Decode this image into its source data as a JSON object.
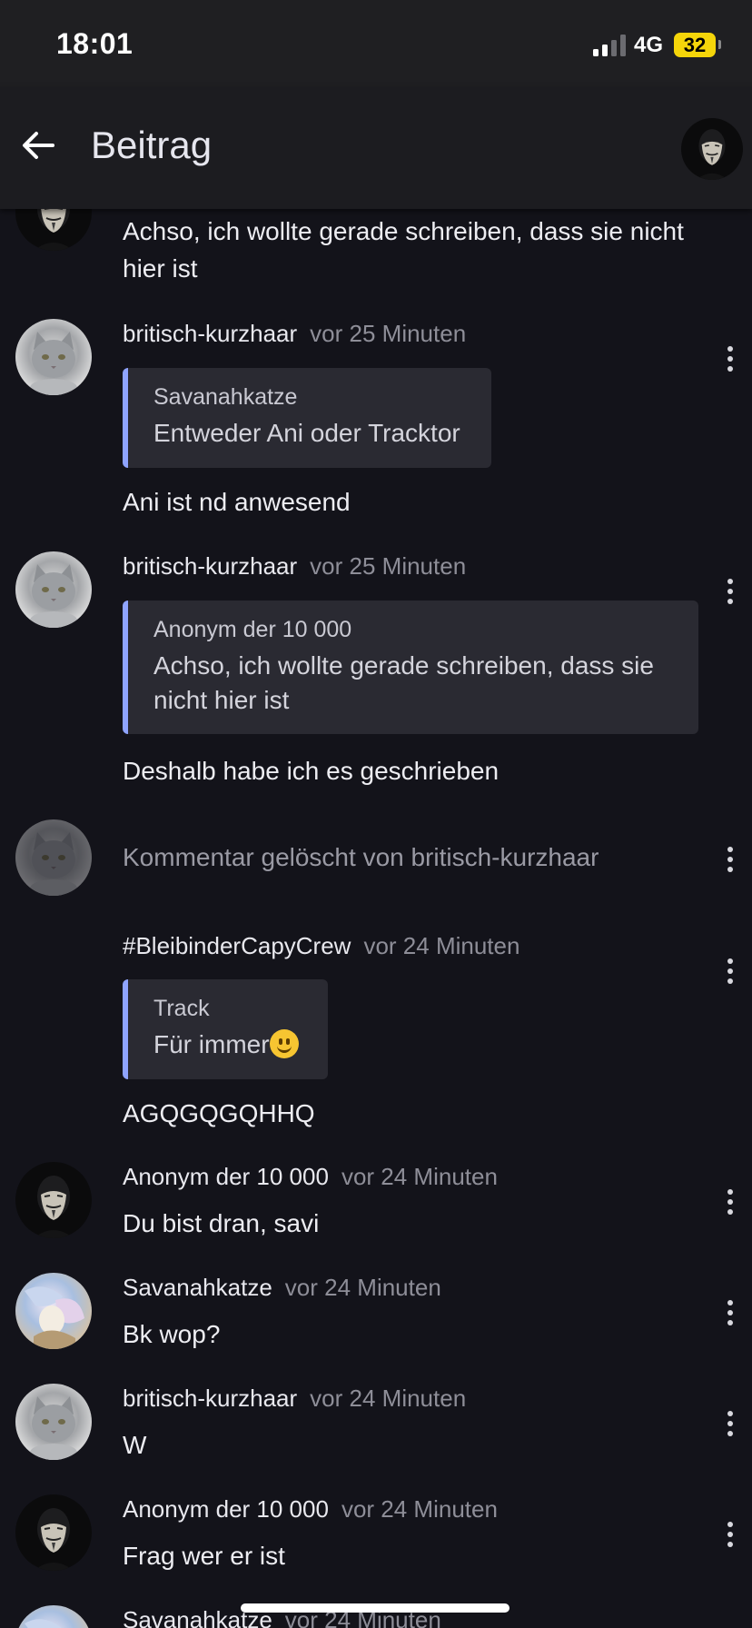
{
  "status_bar": {
    "time": "18:01",
    "network": "4G",
    "battery": "32"
  },
  "header": {
    "title": "Beitrag"
  },
  "posts": [
    {
      "text": "Achso, ich wollte gerade schreiben, dass sie nicht hier ist"
    },
    {
      "username": "britisch-kurzhaar",
      "time": "vor 25 Minuten",
      "quote_author": "Savanahkatze",
      "quote_text": "Entweder Ani oder Tracktor",
      "text": "Ani ist nd anwesend"
    },
    {
      "username": "britisch-kurzhaar",
      "time": "vor 25 Minuten",
      "quote_author": "Anonym der 10 000",
      "quote_text": "Achso, ich wollte gerade schreiben, dass sie nicht hier ist",
      "text": "Deshalb habe ich es geschrieben"
    },
    {
      "deleted_text": "Kommentar gelöscht von britisch-kurzhaar"
    },
    {
      "username": "#BleibinderCapyCrew",
      "time": "vor 24 Minuten",
      "quote_author": "Track",
      "quote_text": "Für immer",
      "text": "AGQGQGQHHQ"
    },
    {
      "username": "Anonym der 10 000",
      "time": "vor 24 Minuten",
      "text": "Du bist dran, savi"
    },
    {
      "username": "Savanahkatze",
      "time": "vor 24 Minuten",
      "text": "Bk wop?"
    },
    {
      "username": "britisch-kurzhaar",
      "time": "vor 24 Minuten",
      "text": "W"
    },
    {
      "username": "Anonym der 10 000",
      "time": "vor 24 Minuten",
      "text": "Frag wer er ist"
    },
    {
      "username": "Savanahkatze",
      "time": "vor 24 Minuten"
    }
  ],
  "icons": {
    "back": "arrow-left-icon",
    "more": "more-vertical-icon",
    "signal": "cellular-signal-icon",
    "emoji": "smiley-emoji-icon"
  },
  "colors": {
    "background": "#13131a",
    "app_bar": "#1c1c20",
    "quote_background": "#2a2a32",
    "quote_accent": "#8fa4ff",
    "battery": "#f5d50a"
  }
}
